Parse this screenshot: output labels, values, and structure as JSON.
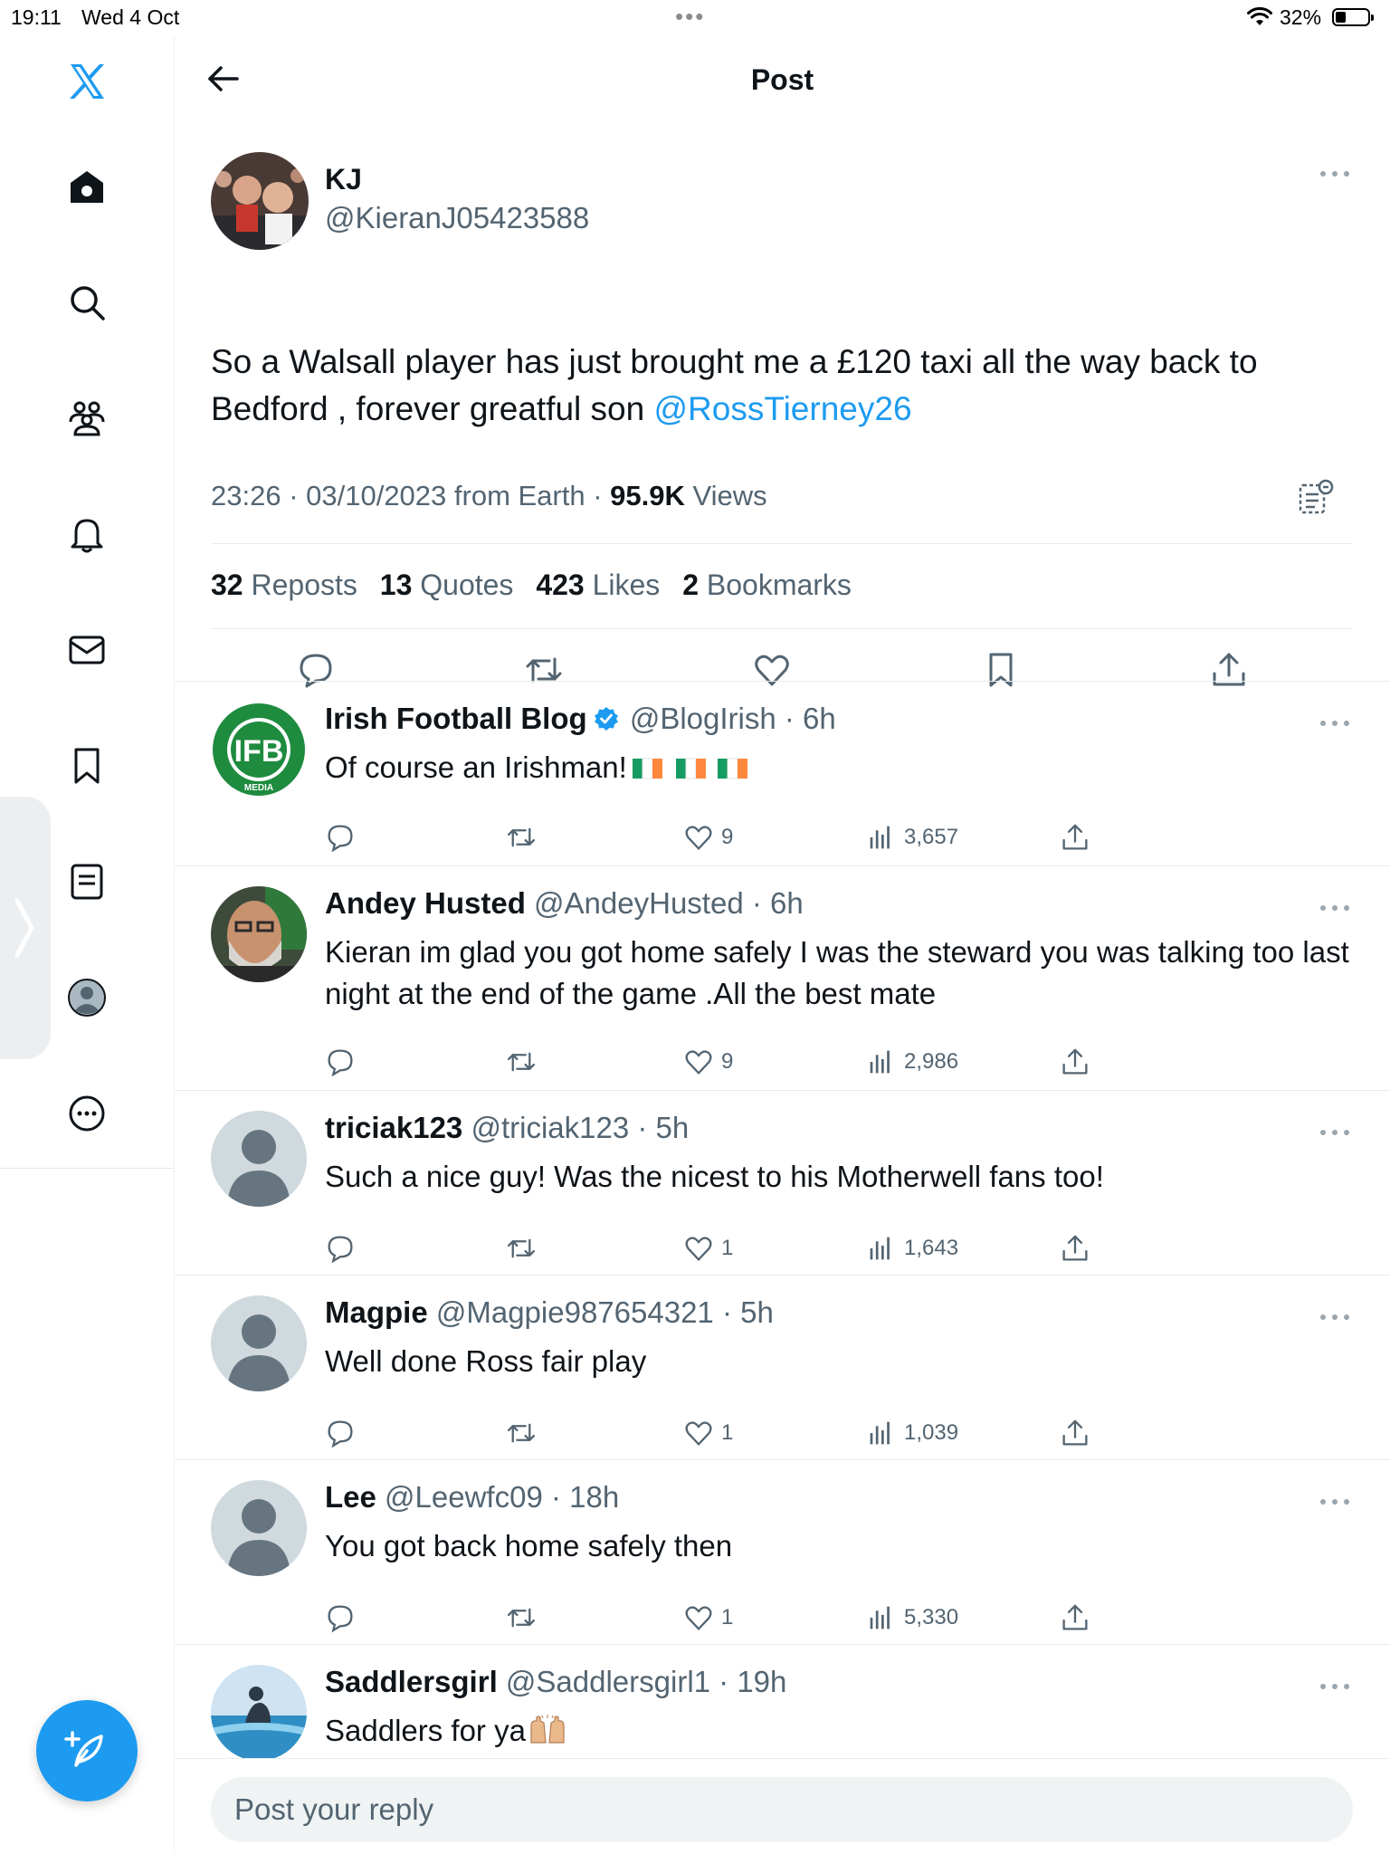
{
  "status": {
    "time": "19:11",
    "date": "Wed 4 Oct",
    "battery": "32%",
    "battery_level": 0.32
  },
  "sidebar": {
    "items": [
      "home",
      "explore",
      "communities",
      "notifications",
      "messages",
      "bookmarks",
      "lists",
      "profile",
      "more"
    ]
  },
  "header": {
    "title": "Post"
  },
  "post": {
    "name": "KJ",
    "handle": "@KieranJ05423588",
    "text_before": "So a Walsall player has just brought me a £120 taxi all the way back to Bedford , forever greatful son ",
    "mention": "@RossTierney26",
    "meta_time": "23:26 · 03/10/2023 from Earth · ",
    "views_count": "95.9K",
    "views_label": " Views",
    "reposts_count": "32",
    "reposts_label": "Reposts",
    "quotes_count": "13",
    "quotes_label": "Quotes",
    "likes_count": "423",
    "likes_label": "Likes",
    "bookmarks_count": "2",
    "bookmarks_label": "Bookmarks"
  },
  "replies": [
    {
      "name": "Irish Football Blog",
      "verified": true,
      "handle": "@BlogIrish · 6h",
      "text": "Of course an Irishman!",
      "likes": "9",
      "views": "3,657"
    },
    {
      "name": "Andey Husted",
      "handle": "@AndeyHusted · 6h",
      "text": "Kieran im glad you got home safely I was the steward you was talking too last night at the end of the game .All the best mate",
      "likes": "9",
      "views": "2,986"
    },
    {
      "name": "triciak123",
      "handle": "@triciak123 · 5h",
      "text": "Such a nice guy! Was the nicest to his Motherwell fans too!",
      "likes": "1",
      "views": "1,643"
    },
    {
      "name": "Magpie",
      "handle": "@Magpie987654321 · 5h",
      "text": "Well done Ross fair play",
      "likes": "1",
      "views": "1,039"
    },
    {
      "name": "Lee",
      "handle": "@Leewfc09 · 18h",
      "text": "You got back home safely then",
      "likes": "1",
      "views": "5,330"
    },
    {
      "name": "Saddlersgirl",
      "handle": "@Saddlersgirl1 · 19h",
      "text": "Saddlers for ya"
    }
  ],
  "reply_box": {
    "placeholder": "Post your reply"
  },
  "colors": {
    "accent": "#1d9bf0",
    "text": "#0f1419",
    "secondary": "#536471",
    "ireland_green": "#169b62",
    "ireland_orange": "#ff883e"
  },
  "icons": {
    "brand": "x-logo-icon",
    "compose": "feather-plus-icon"
  }
}
